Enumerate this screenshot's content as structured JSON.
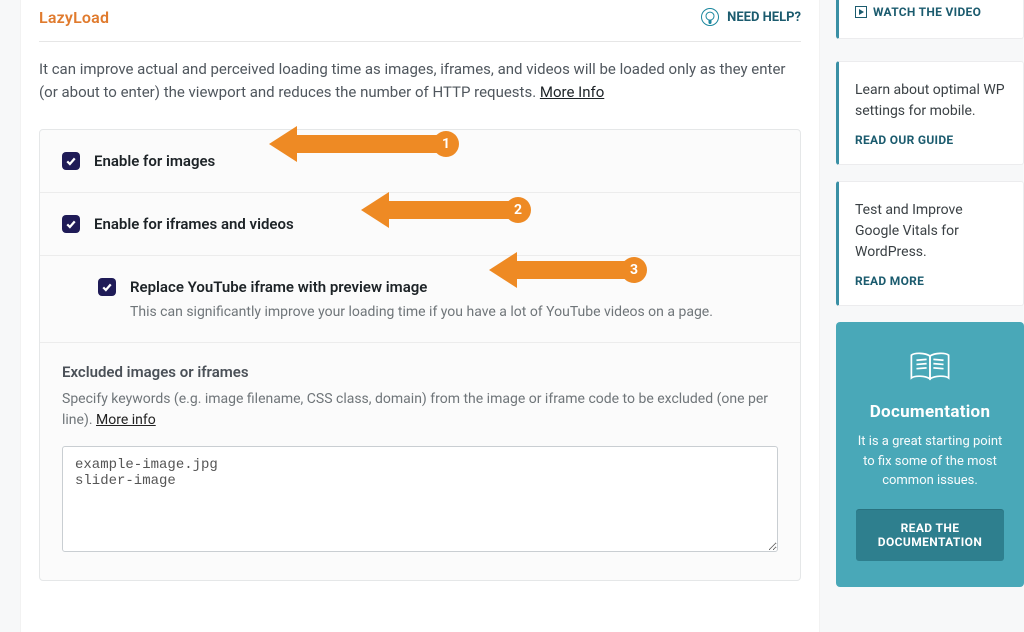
{
  "section": {
    "title": "LazyLoad",
    "help_label": "NEED HELP?",
    "intro_text": "It can improve actual and perceived loading time as images, iframes, and videos will be loaded only as they enter (or about to enter) the viewport and reduces the number of HTTP requests. ",
    "intro_more": "More Info"
  },
  "settings": {
    "enable_images": {
      "label": "Enable for images",
      "checked": true
    },
    "enable_iframes": {
      "label": "Enable for iframes and videos",
      "checked": true
    },
    "replace_youtube": {
      "label": "Replace YouTube iframe with preview image",
      "checked": true,
      "description": "This can significantly improve your loading time if you have a lot of YouTube videos on a page."
    },
    "excluded": {
      "title": "Excluded images or iframes",
      "description": "Specify keywords (e.g. image filename, CSS class, domain) from the image or iframe code to be excluded (one per line). ",
      "more": "More info",
      "value": "example-image.jpg\nslider-image"
    }
  },
  "annotations": {
    "a1": "1",
    "a2": "2",
    "a3": "3"
  },
  "sidebar": {
    "video_link": "WATCH THE VIDEO",
    "guide": {
      "text": "Learn about optimal WP settings for mobile.",
      "link": "READ OUR GUIDE"
    },
    "vitals": {
      "text": "Test and Improve Google Vitals for WordPress.",
      "link": "READ MORE"
    },
    "documentation": {
      "title": "Documentation",
      "text": "It is a great starting point to fix some of the most common issues.",
      "button": "READ THE DOCUMENTATION"
    }
  }
}
